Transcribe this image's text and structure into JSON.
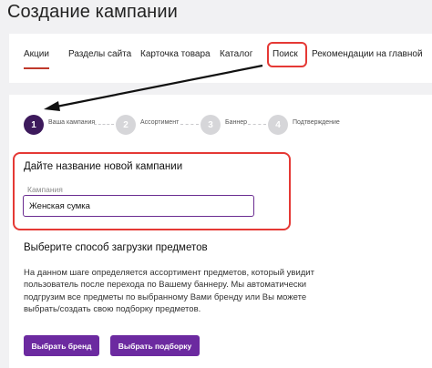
{
  "page": {
    "title": "Создание кампании"
  },
  "tabs": [
    {
      "label": "Акции"
    },
    {
      "label": "Разделы сайта"
    },
    {
      "label": "Карточка товара"
    },
    {
      "label": "Каталог"
    },
    {
      "label": "Поиск"
    },
    {
      "label": "Рекомендации на главной"
    }
  ],
  "steps": [
    {
      "number": "1",
      "label": "Ваша кампания"
    },
    {
      "number": "2",
      "label": "Ассортимент"
    },
    {
      "number": "3",
      "label": "Баннер"
    },
    {
      "number": "4",
      "label": "Подтверждение"
    }
  ],
  "name_section": {
    "title": "Дайте название новой кампании",
    "field_label": "Кампания",
    "field_value": "Женская сумка"
  },
  "upload_section": {
    "title": "Выберите способ загрузки предметов",
    "description": "На данном шаге определяется ассортимент предметов, который увидит пользователь после перехода по Вашему баннеру. Мы автоматически подгрузим все предметы по выбранному Вами бренду или Вы можете выбрать/создать свою подборку предметов."
  },
  "buttons": {
    "choose_brand": "Выбрать бренд",
    "choose_selection": "Выбрать подборку"
  },
  "colors": {
    "accent": "#6c2aa0",
    "active_step": "#3d1a5c",
    "annotation": "#e53935"
  }
}
